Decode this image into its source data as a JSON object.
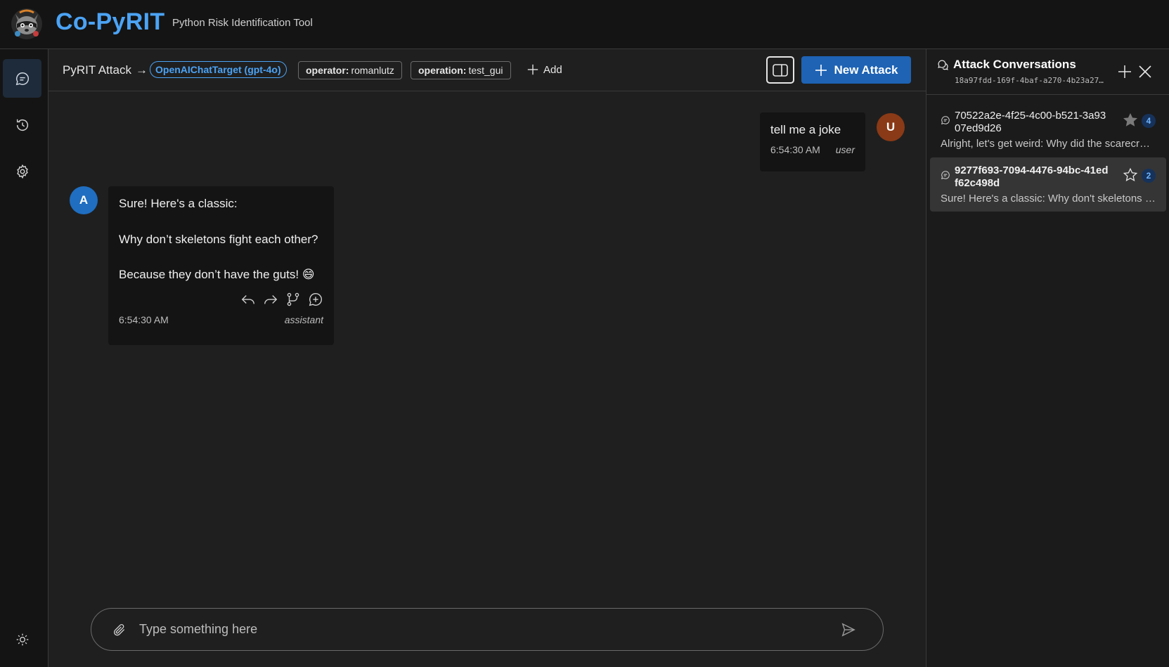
{
  "app": {
    "title": "Co-PyRIT",
    "subtitle": "Python Risk Identification Tool"
  },
  "toolbar": {
    "breadcrumb": "PyRIT Attack",
    "arrow": "→",
    "target": "OpenAIChatTarget (gpt-4o)",
    "labels": [
      {
        "key": "operator:",
        "value": "romanlutz"
      },
      {
        "key": "operation:",
        "value": "test_gui"
      }
    ],
    "add_label": "Add",
    "new_attack_label": "New Attack"
  },
  "messages": [
    {
      "role": "user",
      "avatar": "U",
      "text": [
        "tell me a joke"
      ],
      "time": "6:54:30 AM"
    },
    {
      "role": "assistant",
      "avatar": "A",
      "text": [
        "Sure! Here's a classic:",
        "Why don’t skeletons fight each other?",
        "Because they don’t have the guts! 😄"
      ],
      "time": "6:54:30 AM"
    }
  ],
  "input": {
    "placeholder": "Type something here",
    "value": ""
  },
  "panel": {
    "title": "Attack Conversations",
    "attack_id": "18a97fdd-169f-4baf-a270-4b23a27…",
    "conversations": [
      {
        "id": "70522a2e-4f25-4c00-b521-3a9307ed9d26",
        "preview": "Alright, let's get weird: Why did the scarecrow…",
        "count": "4",
        "starred": true,
        "selected": false
      },
      {
        "id": "9277f693-7094-4476-94bc-41edf62c498d",
        "preview": "Sure! Here's a classic: Why don't skeletons fi…",
        "count": "2",
        "starred": false,
        "selected": true
      }
    ]
  },
  "nav": {
    "items": [
      {
        "name": "chat",
        "icon": "chat-icon",
        "active": true
      },
      {
        "name": "history",
        "icon": "history-icon",
        "active": false
      },
      {
        "name": "settings",
        "icon": "gear-icon",
        "active": false
      }
    ],
    "theme_icon": "sun-icon"
  },
  "colors": {
    "accent": "#4ba3f5",
    "primary_button": "#1e63b4",
    "user_avatar": "#8a3a16",
    "assistant_avatar": "#1f6ec1",
    "background": "#1f1f1f",
    "surface": "#141414"
  }
}
